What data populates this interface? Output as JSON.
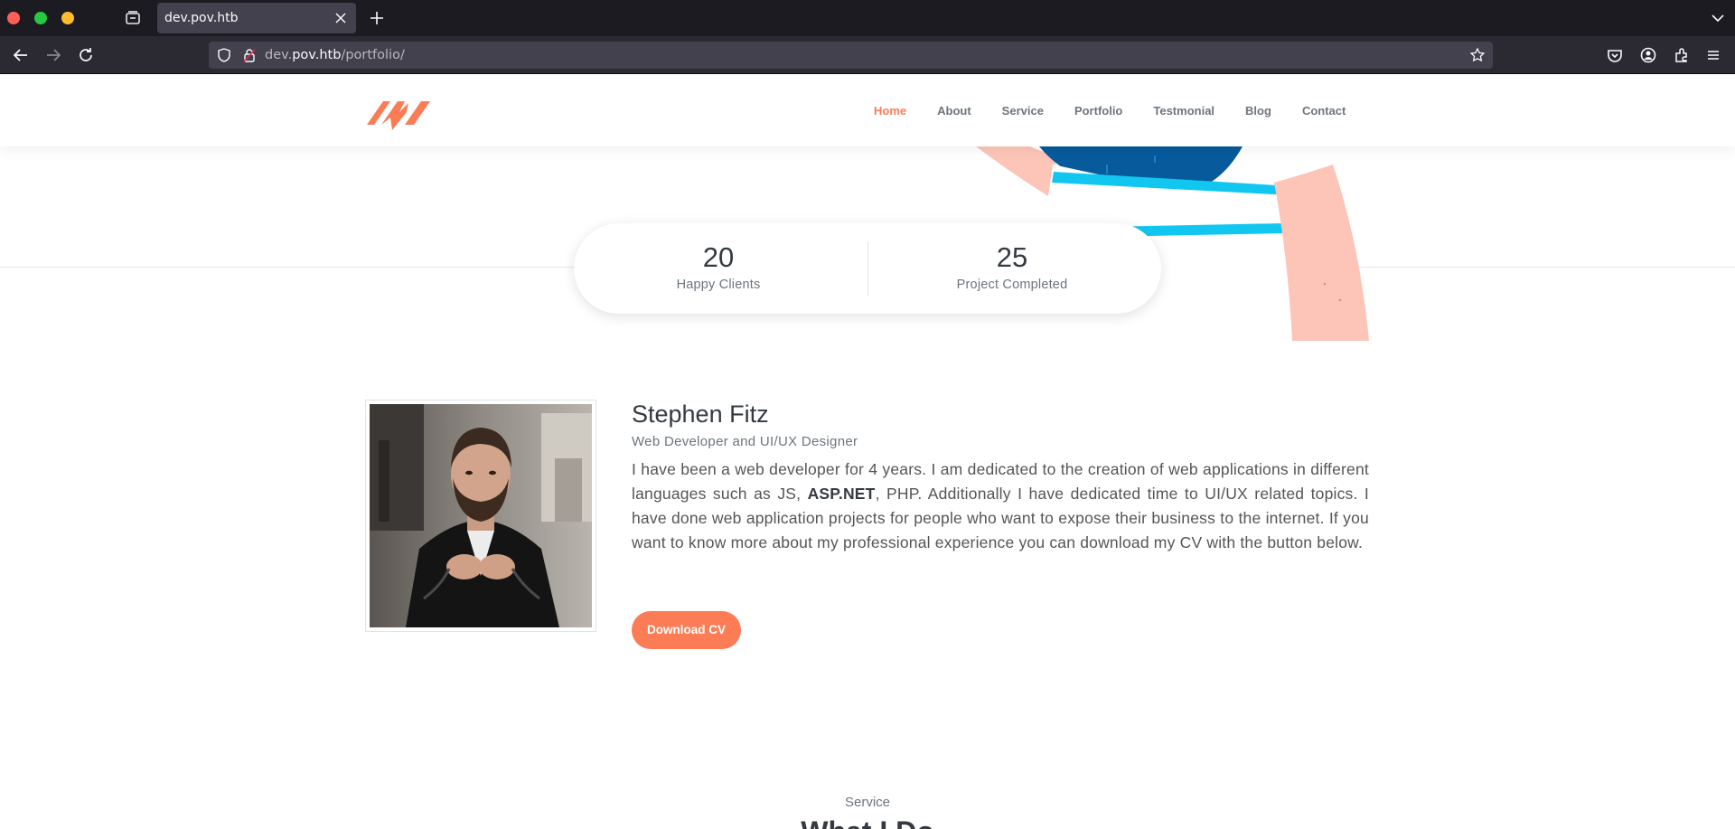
{
  "browser": {
    "tab_title": "dev.pov.htb",
    "url_prefix": "dev.",
    "url_host": "pov.htb",
    "url_path": "/portfolio/"
  },
  "nav": {
    "items": [
      {
        "label": "Home",
        "active": true
      },
      {
        "label": "About",
        "active": false
      },
      {
        "label": "Service",
        "active": false
      },
      {
        "label": "Portfolio",
        "active": false
      },
      {
        "label": "Testmonial",
        "active": false
      },
      {
        "label": "Blog",
        "active": false
      },
      {
        "label": "Contact",
        "active": false
      }
    ]
  },
  "stats": [
    {
      "value": "20",
      "label": "Happy Clients"
    },
    {
      "value": "25",
      "label": "Project Completed"
    }
  ],
  "about": {
    "name": "Stephen Fitz",
    "role": "Web Developer and UI/UX Designer",
    "bio_part1": "I have been a web developer for 4 years. I am dedicated to the creation of web applications in different languages such as JS, ",
    "bio_bold": "ASP.NET",
    "bio_part2": ", PHP. Additionally I have dedicated time to UI/UX related topics. I have done web application projects for people who want to expose their business to the internet. If you want to know more about my professional experience you can download my CV with the button below.",
    "cv_button": "Download CV"
  },
  "services": {
    "kicker": "Service",
    "title": "What I Do"
  },
  "colors": {
    "accent": "#fb7c55",
    "text_dark": "#343a40",
    "text_muted": "#6c757d"
  }
}
